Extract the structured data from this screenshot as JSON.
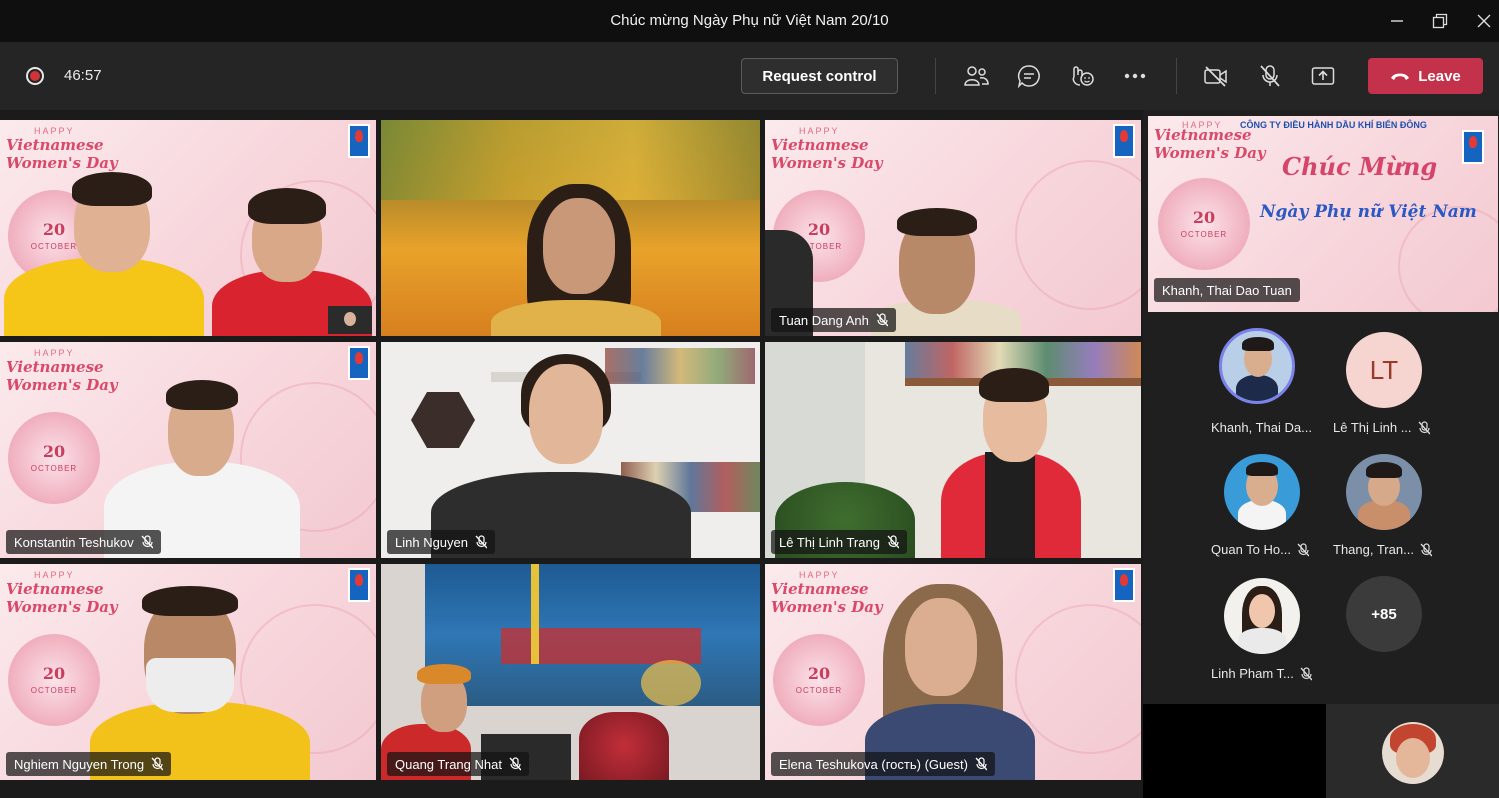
{
  "window": {
    "title": "Chúc mừng Ngày Phụ nữ Việt Nam 20/10"
  },
  "toolbar": {
    "timer": "46:57",
    "request_control": "Request control",
    "leave": "Leave"
  },
  "banner": {
    "happy": "HAPPY",
    "line1": "Vietnamese",
    "line2": "Women's Day",
    "day": "20",
    "month": "OCTOBER"
  },
  "featured": {
    "company": "CÔNG TY ĐIỀU HÀNH DẦU KHÍ BIỂN ĐÔNG",
    "greeting1": "Chúc Mừng",
    "greeting2": "Ngày Phụ nữ Việt Nam",
    "name": "Khanh, Thai Dao Tuan"
  },
  "tiles": [
    {
      "name": ""
    },
    {
      "name": ""
    },
    {
      "name": "Tuan Dang Anh"
    },
    {
      "name": "Konstantin Teshukov"
    },
    {
      "name": "Linh Nguyen"
    },
    {
      "name": "Lê Thị Linh Trang"
    },
    {
      "name": "Nghiem Nguyen Trong"
    },
    {
      "name": "Quang Trang Nhat"
    },
    {
      "name": "Elena Teshukova (гость) (Guest)"
    }
  ],
  "roster": [
    {
      "name": "Khanh, Thai Da...",
      "initials": ""
    },
    {
      "name": "Lê Thị Linh ...",
      "initials": "LT"
    },
    {
      "name": "Quan To Ho...",
      "initials": ""
    },
    {
      "name": "Thang, Tran...",
      "initials": ""
    },
    {
      "name": "Linh Pham T...",
      "initials": ""
    },
    {
      "name": "",
      "initials": "+85"
    }
  ],
  "colors": {
    "leave": "#c4314b",
    "record": "#d13438",
    "avatar_ring": "#7b83eb"
  }
}
